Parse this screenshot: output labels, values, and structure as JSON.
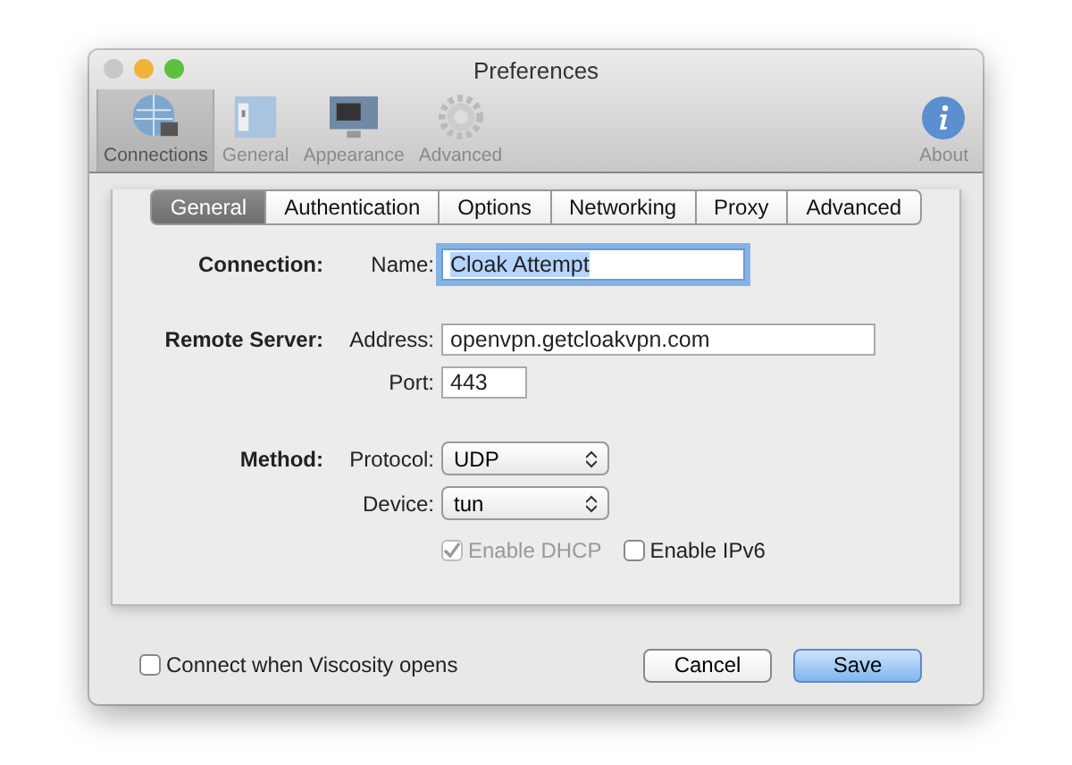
{
  "window": {
    "title": "Preferences"
  },
  "toolbar": {
    "items": [
      {
        "label": "Connections",
        "kind": "globe",
        "selected": true
      },
      {
        "label": "General",
        "kind": "switch",
        "selected": false
      },
      {
        "label": "Appearance",
        "kind": "monitor",
        "selected": false
      },
      {
        "label": "Advanced",
        "kind": "gear",
        "selected": false
      }
    ],
    "about": {
      "label": "About"
    }
  },
  "tabs": [
    {
      "label": "General",
      "selected": true
    },
    {
      "label": "Authentication",
      "selected": false
    },
    {
      "label": "Options",
      "selected": false
    },
    {
      "label": "Networking",
      "selected": false
    },
    {
      "label": "Proxy",
      "selected": false
    },
    {
      "label": "Advanced",
      "selected": false
    }
  ],
  "sections": [
    {
      "title": "Connection:",
      "rows": [
        {
          "label": "Name:",
          "kind": "text",
          "value": "Cloak Attempt",
          "focused": true,
          "text_selected": true
        }
      ]
    },
    {
      "title": "Remote Server:",
      "rows": [
        {
          "label": "Address:",
          "kind": "text",
          "value": "openvpn.getcloakvpn.com",
          "focused": false,
          "text_selected": false
        },
        {
          "label": "Port:",
          "kind": "text",
          "value": "443",
          "focused": false,
          "text_selected": false
        }
      ]
    },
    {
      "title": "Method:",
      "rows": [
        {
          "label": "Protocol:",
          "kind": "select",
          "value": "UDP"
        },
        {
          "label": "Device:",
          "kind": "select",
          "value": "tun"
        }
      ]
    }
  ],
  "options": [
    {
      "label": "Enable DHCP",
      "checked": true,
      "disabled": true
    },
    {
      "label": "Enable IPv6",
      "checked": false,
      "disabled": false
    }
  ],
  "footer": {
    "checkbox": {
      "label": "Connect when Viscosity opens",
      "checked": false
    },
    "buttons": [
      {
        "label": "Cancel",
        "kind": "normal"
      },
      {
        "label": "Save",
        "kind": "default"
      }
    ]
  }
}
